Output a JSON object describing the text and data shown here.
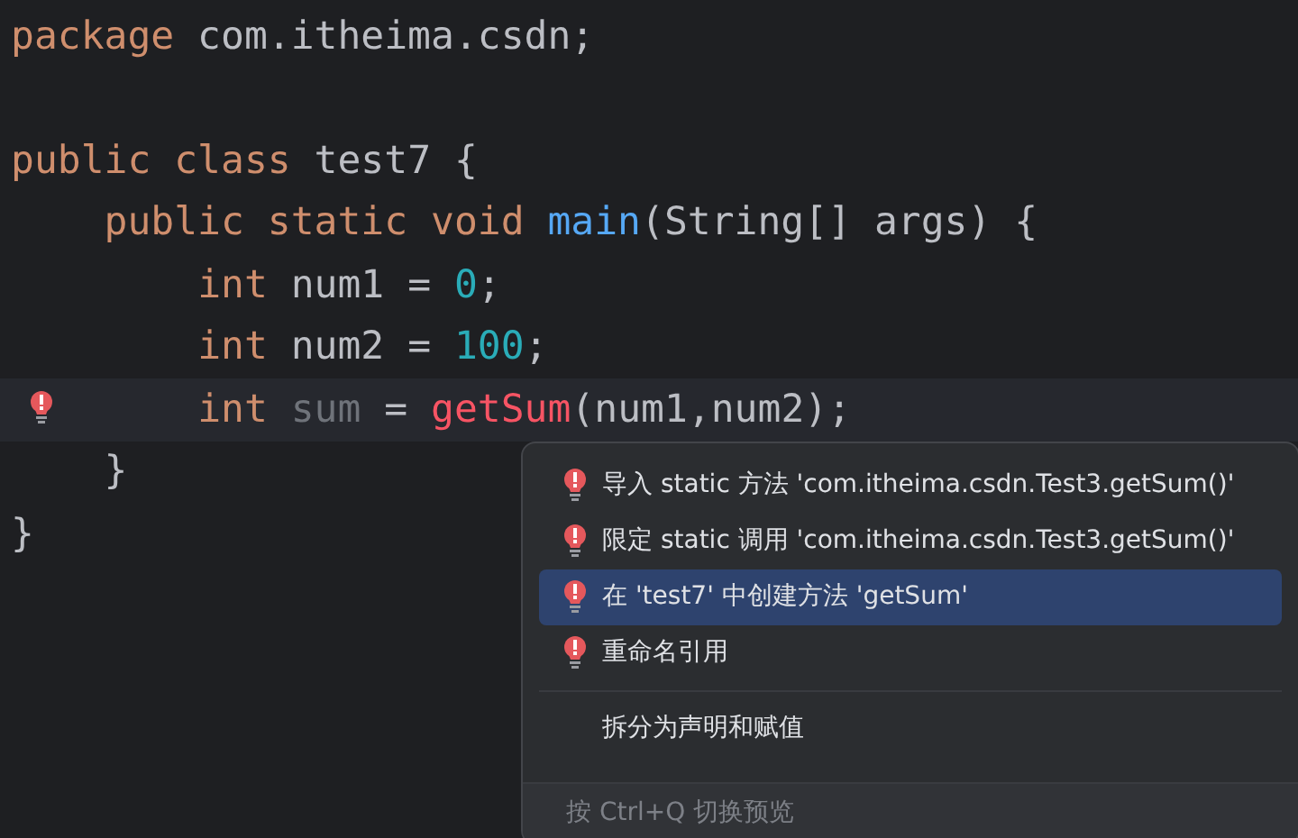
{
  "editor": {
    "lines": [
      {
        "current": false,
        "error_marker": false,
        "tokens": [
          {
            "text": "package",
            "kind": "keyword"
          },
          {
            "text": " com.itheima.csdn;",
            "kind": "plain"
          }
        ]
      },
      {
        "current": false,
        "error_marker": false
      },
      {
        "current": false,
        "error_marker": false,
        "tokens": [
          {
            "text": "public class",
            "kind": "keyword"
          },
          {
            "text": " test7 {",
            "kind": "plain"
          }
        ]
      },
      {
        "current": false,
        "error_marker": false,
        "tokens": [
          {
            "text": "    public static void",
            "kind": "keyword"
          },
          {
            "text": " main",
            "kind": "method"
          },
          {
            "text": "(String[] args) {",
            "kind": "plain"
          }
        ]
      },
      {
        "current": false,
        "error_marker": false,
        "tokens": [
          {
            "text": "        int",
            "kind": "keyword"
          },
          {
            "text": " num1 = ",
            "kind": "plain"
          },
          {
            "text": "0",
            "kind": "number"
          },
          {
            "text": ";",
            "kind": "plain"
          }
        ]
      },
      {
        "current": false,
        "error_marker": false,
        "tokens": [
          {
            "text": "        int",
            "kind": "keyword"
          },
          {
            "text": " num2 = ",
            "kind": "plain"
          },
          {
            "text": "100",
            "kind": "number"
          },
          {
            "text": ";",
            "kind": "plain"
          }
        ]
      },
      {
        "current": true,
        "error_marker": true,
        "tokens": [
          {
            "text": "        int",
            "kind": "keyword"
          },
          {
            "text": " sum",
            "kind": "unused"
          },
          {
            "text": " = ",
            "kind": "plain"
          },
          {
            "text": "getSum",
            "kind": "error"
          },
          {
            "text": "(num1,num2);",
            "kind": "plain"
          }
        ]
      },
      {
        "current": false,
        "error_marker": false,
        "tokens": [
          {
            "text": "    }",
            "kind": "plain"
          }
        ]
      },
      {
        "current": false,
        "error_marker": false,
        "tokens": [
          {
            "text": "}",
            "kind": "plain"
          }
        ]
      }
    ]
  },
  "popup": {
    "items": [
      {
        "kind": "fix",
        "label": "导入 static 方法 'com.itheima.csdn.Test3.getSum()'",
        "selected": false
      },
      {
        "kind": "fix",
        "label": "限定 static 调用 'com.itheima.csdn.Test3.getSum()'",
        "selected": false
      },
      {
        "kind": "fix",
        "label": "在 'test7' 中创建方法 'getSum'",
        "selected": true
      },
      {
        "kind": "fix",
        "label": "重命名引用",
        "selected": false
      },
      {
        "kind": "separator"
      },
      {
        "kind": "action",
        "label": "拆分为声明和赋值",
        "selected": false
      }
    ],
    "footer": "按 Ctrl+Q 切换预览"
  }
}
